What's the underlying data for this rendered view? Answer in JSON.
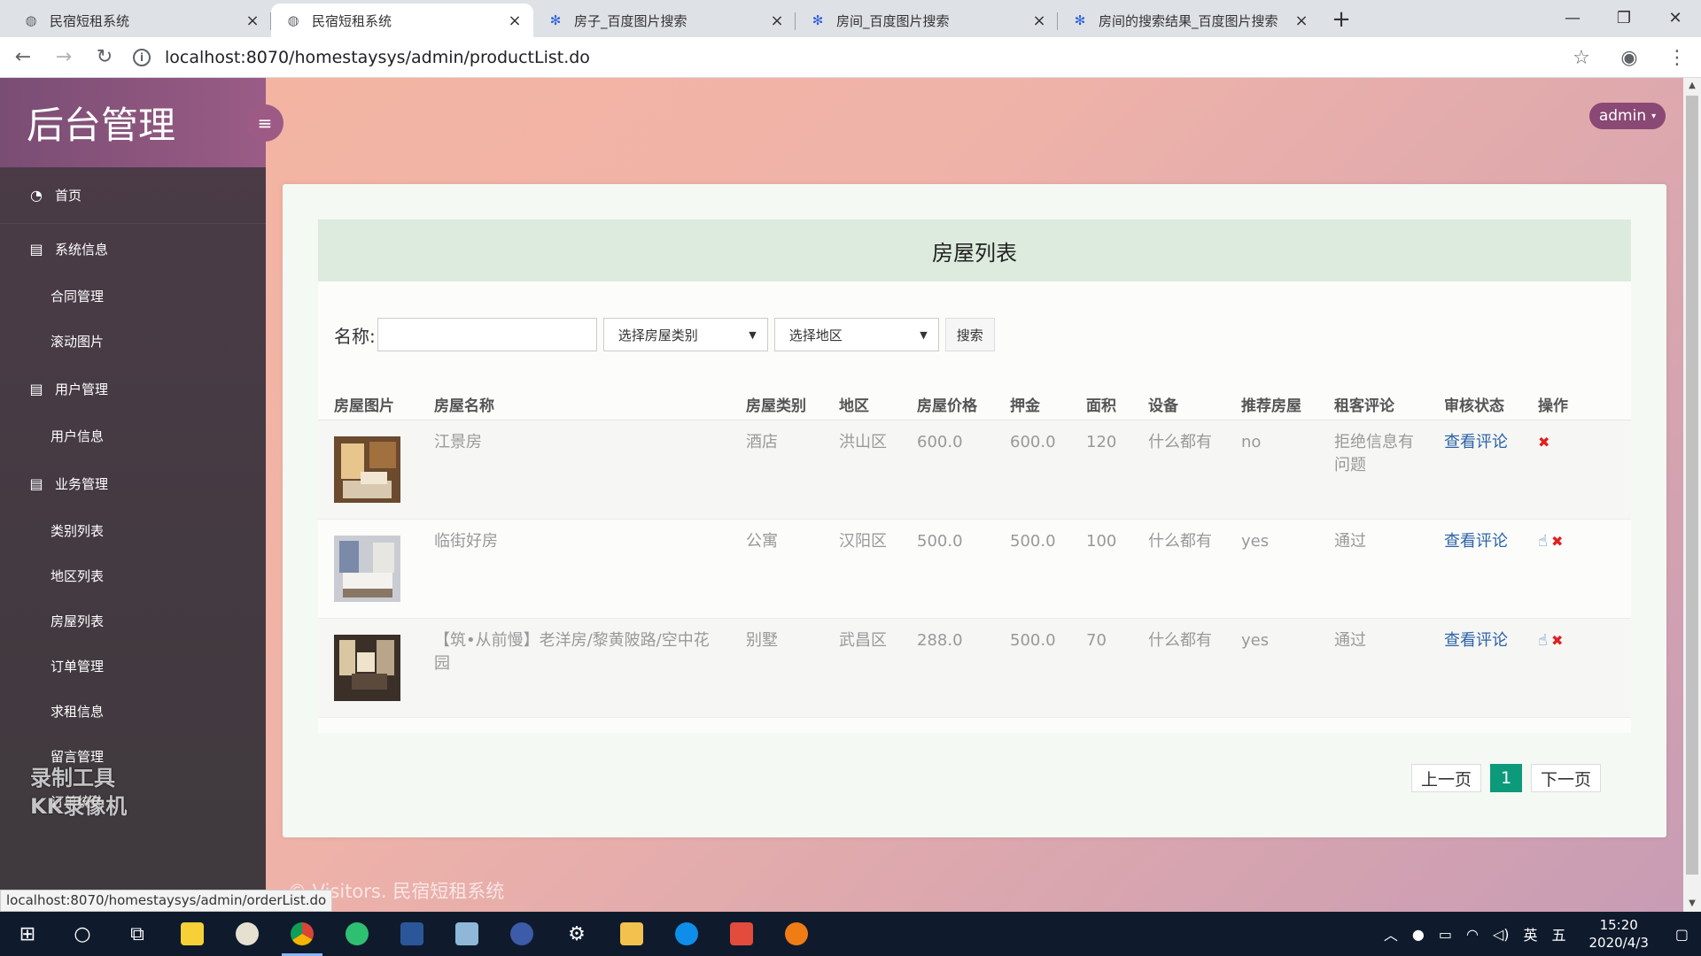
{
  "browser": {
    "tabs": [
      {
        "title": "民宿短租系统",
        "icon": "globe-icon",
        "active": false
      },
      {
        "title": "民宿短租系统",
        "icon": "globe-icon",
        "active": true
      },
      {
        "title": "房子_百度图片搜索",
        "icon": "baidu-paw-icon",
        "active": false
      },
      {
        "title": "房间_百度图片搜索",
        "icon": "baidu-paw-icon",
        "active": false
      },
      {
        "title": "房间的搜索结果_百度图片搜索",
        "icon": "baidu-paw-icon",
        "active": false
      }
    ],
    "url": "localhost:8070/homestaysys/admin/productList.do",
    "status_url": "localhost:8070/homestaysys/admin/orderList.do"
  },
  "sidebar": {
    "brand": "后台管理",
    "home": "首页",
    "groups": [
      {
        "label": "系统信息",
        "items": [
          "合同管理",
          "滚动图片"
        ]
      },
      {
        "label": "用户管理",
        "items": [
          "用户信息"
        ]
      },
      {
        "label": "业务管理",
        "items": [
          "类别列表",
          "地区列表",
          "房屋列表",
          "订单管理",
          "求租信息",
          "留言管理",
          "订单统计"
        ]
      }
    ],
    "watermark": [
      "录制工具",
      "KK录像机"
    ]
  },
  "header": {
    "user": "admin"
  },
  "main": {
    "title": "房屋列表",
    "search": {
      "name_label": "名称:",
      "name_value": "",
      "category_select": "选择房屋类别",
      "region_select": "选择地区",
      "button": "搜索"
    },
    "columns": [
      "房屋图片",
      "房屋名称",
      "房屋类别",
      "地区",
      "房屋价格",
      "押金",
      "面积",
      "设备",
      "推荐房屋",
      "租客评论",
      "审核状态",
      "操作"
    ],
    "rows": [
      {
        "name": "江景房",
        "category": "酒店",
        "region": "洪山区",
        "price": "600.0",
        "deposit": "600.0",
        "area": "120",
        "equipment": "什么都有",
        "recommend": "no",
        "review": "拒绝信息有问题",
        "status_link": "查看评论",
        "approve": false
      },
      {
        "name": "临街好房",
        "category": "公寓",
        "region": "汉阳区",
        "price": "500.0",
        "deposit": "500.0",
        "area": "100",
        "equipment": "什么都有",
        "recommend": "yes",
        "review": "通过",
        "status_link": "查看评论",
        "approve": true
      },
      {
        "name": "【筑•从前慢】老洋房/黎黄陂路/空中花园",
        "category": "别墅",
        "region": "武昌区",
        "price": "288.0",
        "deposit": "500.0",
        "area": "70",
        "equipment": "什么都有",
        "recommend": "yes",
        "review": "通过",
        "status_link": "查看评论",
        "approve": true
      }
    ],
    "pager": {
      "prev": "上一页",
      "current": "1",
      "next": "下一页"
    }
  },
  "footer": "© Visitors. 民宿短租系统",
  "taskbar": {
    "time": "15:20",
    "date": "2020/4/3",
    "ime": "英",
    "ime2": "五"
  },
  "colors": {
    "accent": "#0c9a7a",
    "link": "#2b63a8",
    "delete": "#e02020",
    "brand": "#8a4874"
  }
}
